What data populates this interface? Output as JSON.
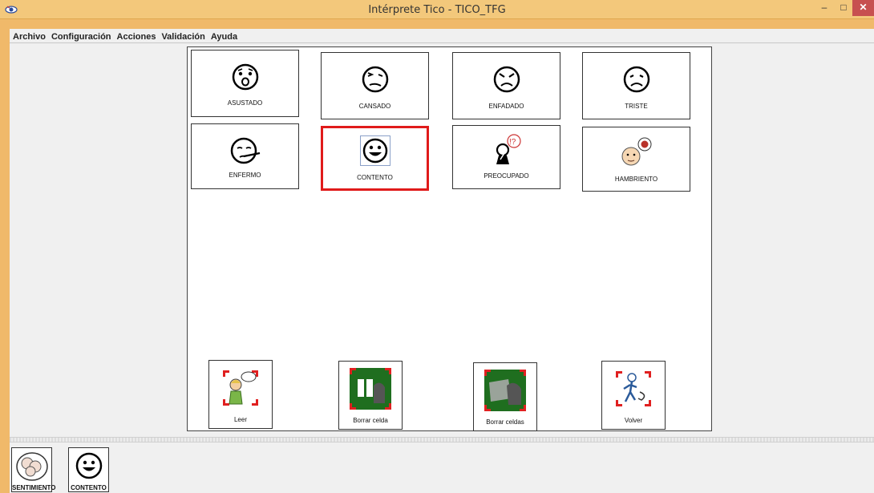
{
  "window": {
    "title": "Intérprete Tico - TICO_TFG",
    "controls": {
      "minimize": "–",
      "maximize": "□",
      "close": "✕"
    }
  },
  "menu": [
    "Archivo",
    "Configuración",
    "Acciones",
    "Validación",
    "Ayuda"
  ],
  "board": {
    "cells": [
      {
        "label": "ASUSTADO",
        "icon": "scared-face-icon",
        "selected": false
      },
      {
        "label": "CANSADO",
        "icon": "tired-face-icon",
        "selected": false
      },
      {
        "label": "ENFADADO",
        "icon": "angry-face-icon",
        "selected": false
      },
      {
        "label": "TRISTE",
        "icon": "sad-face-icon",
        "selected": false
      },
      {
        "label": "ENFERMO",
        "icon": "sick-face-icon",
        "selected": false
      },
      {
        "label": "CONTENTO",
        "icon": "happy-face-icon",
        "selected": true
      },
      {
        "label": "PREOCUPADO",
        "icon": "worried-person-icon",
        "selected": false
      },
      {
        "label": "HAMBRIENTO",
        "icon": "hungry-person-icon",
        "selected": false
      }
    ],
    "actions": [
      {
        "label": "Leer",
        "icon": "speaking-person-icon"
      },
      {
        "label": "Borrar celda",
        "icon": "erase-cell-icon"
      },
      {
        "label": "Borrar celdas",
        "icon": "erase-cells-icon"
      },
      {
        "label": "Volver",
        "icon": "walk-back-icon"
      }
    ]
  },
  "sentence": [
    {
      "label": "SENTIMIENTO",
      "icon": "faces-group-icon"
    },
    {
      "label": "CONTENTO",
      "icon": "happy-face-icon"
    }
  ],
  "colors": {
    "title_bar": "#f3c87b",
    "selected_border": "#e01b1b",
    "action_green": "#1f6e1f"
  }
}
